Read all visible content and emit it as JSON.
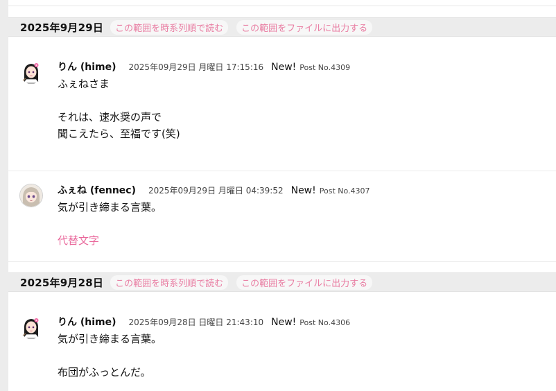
{
  "groups": [
    {
      "date": "2025年9月29日",
      "read_chrono": "この範囲を時系列順で読む",
      "export_file": "この範囲をファイルに出力する",
      "posts": [
        {
          "author": "りん (hime)",
          "timestamp": "2025年09月29日 月曜日 17:15:16",
          "new": "New!",
          "post_no": "Post No.4309",
          "lines": [
            "ふぇねさま",
            "",
            "それは、速水奨の声で",
            "聞こえたら、至福です(笑)"
          ]
        },
        {
          "author": "ふぇね (fennec)",
          "timestamp": "2025年09月29日 月曜日 04:39:52",
          "new": "New!",
          "post_no": "Post No.4307",
          "lines": [
            "気が引き締まる言葉。",
            ""
          ],
          "link": "代替文字"
        }
      ]
    },
    {
      "date": "2025年9月28日",
      "read_chrono": "この範囲を時系列順で読む",
      "export_file": "この範囲をファイルに出力する",
      "posts": [
        {
          "author": "りん (hime)",
          "timestamp": "2025年09月28日 日曜日 21:43:10",
          "new": "New!",
          "post_no": "Post No.4306",
          "lines": [
            "気が引き締まる言葉。",
            "",
            "布団がふっとんだ。"
          ]
        }
      ]
    }
  ],
  "colors": {
    "accent_pink": "#e97ea3",
    "date_bar_bg": "#ececec"
  },
  "icons": {
    "hime_avatar": "anime-girl-black-hair-avatar-icon",
    "fennec_avatar": "anime-girl-silver-hair-avatar-icon"
  }
}
